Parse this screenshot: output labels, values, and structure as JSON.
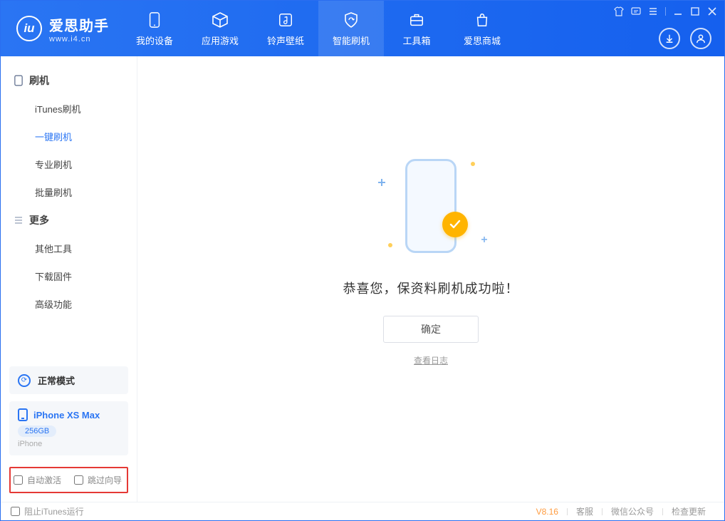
{
  "app": {
    "title": "爱思助手",
    "subtitle": "www.i4.cn"
  },
  "nav": {
    "items": [
      {
        "label": "我的设备"
      },
      {
        "label": "应用游戏"
      },
      {
        "label": "铃声壁纸"
      },
      {
        "label": "智能刷机"
      },
      {
        "label": "工具箱"
      },
      {
        "label": "爱思商城"
      }
    ],
    "active_index": 3
  },
  "sidebar": {
    "section1_title": "刷机",
    "section1_items": [
      "iTunes刷机",
      "一键刷机",
      "专业刷机",
      "批量刷机"
    ],
    "section1_active": 1,
    "section2_title": "更多",
    "section2_items": [
      "其他工具",
      "下载固件",
      "高级功能"
    ]
  },
  "mode": {
    "label": "正常模式"
  },
  "device": {
    "name": "iPhone XS Max",
    "capacity": "256GB",
    "type": "iPhone"
  },
  "options": {
    "auto_activate_label": "自动激活",
    "skip_guide_label": "跳过向导",
    "auto_activate_checked": false,
    "skip_guide_checked": false
  },
  "main": {
    "success_text": "恭喜您，保资料刷机成功啦！",
    "ok_button": "确定",
    "view_log": "查看日志"
  },
  "footer": {
    "block_itunes_label": "阻止iTunes运行",
    "block_itunes_checked": false,
    "version": "V8.16",
    "links": [
      "客服",
      "微信公众号",
      "检查更新"
    ]
  },
  "colors": {
    "primary": "#2a75f3",
    "accent": "#ffb400"
  }
}
